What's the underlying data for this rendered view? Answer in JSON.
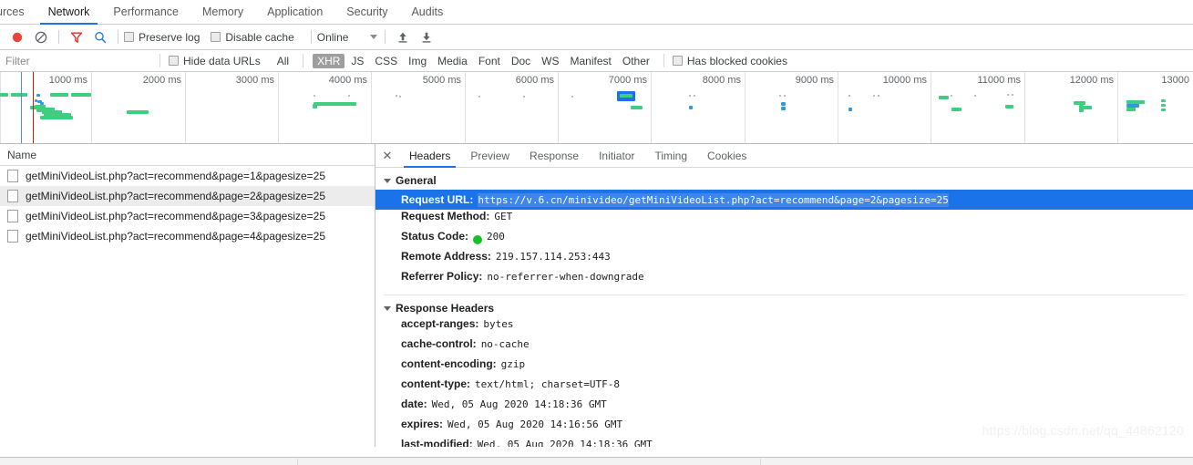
{
  "tabstrip": {
    "tabs": [
      {
        "label": "urces",
        "active": false,
        "clipped": true
      },
      {
        "label": "Network",
        "active": true
      },
      {
        "label": "Performance",
        "active": false
      },
      {
        "label": "Memory",
        "active": false
      },
      {
        "label": "Application",
        "active": false
      },
      {
        "label": "Security",
        "active": false
      },
      {
        "label": "Audits",
        "active": false
      }
    ]
  },
  "toolbar": {
    "record_icon": "record-icon",
    "clear_icon": "clear-icon",
    "filter_icon": "filter-icon",
    "search_icon": "search-icon",
    "preserve_log_label": "Preserve log",
    "preserve_log_checked": false,
    "disable_cache_label": "Disable cache",
    "disable_cache_checked": false,
    "throttling_value": "Online",
    "import_icon": "upload-arrow-icon",
    "export_icon": "download-arrow-icon",
    "record_color": "#e8453c",
    "filter_color": "#d93025",
    "search_color": "#1a73e8"
  },
  "filterbar": {
    "filter_placeholder": "Filter",
    "filter_value": "",
    "hide_data_urls_label": "Hide data URLs",
    "hide_data_urls_checked": false,
    "types": [
      {
        "label": "All",
        "selected": false
      },
      {
        "label": "XHR",
        "selected": true
      },
      {
        "label": "JS",
        "selected": false
      },
      {
        "label": "CSS",
        "selected": false
      },
      {
        "label": "Img",
        "selected": false
      },
      {
        "label": "Media",
        "selected": false
      },
      {
        "label": "Font",
        "selected": false
      },
      {
        "label": "Doc",
        "selected": false
      },
      {
        "label": "WS",
        "selected": false
      },
      {
        "label": "Manifest",
        "selected": false
      },
      {
        "label": "Other",
        "selected": false
      }
    ],
    "has_blocked_cookies_label": "Has blocked cookies",
    "has_blocked_cookies_checked": false
  },
  "overview": {
    "tick_labels": [
      "1000 ms",
      "2000 ms",
      "3000 ms",
      "4000 ms",
      "5000 ms",
      "6000 ms",
      "7000 ms",
      "8000 ms",
      "9000 ms",
      "10000 ms",
      "11000 ms",
      "12000 ms",
      "13000"
    ],
    "tick_x": [
      100,
      203,
      305,
      407,
      510,
      612,
      714,
      817,
      919,
      1021,
      1124,
      1226,
      1309
    ],
    "bar_color": "#41cd7f",
    "selected_bar_color": "#1a73e8",
    "dom_marker_color": "#4d8ee0",
    "load_marker_color": "#a52714"
  },
  "requests": {
    "column_header": "Name",
    "rows": [
      {
        "name": "getMiniVideoList.php?act=recommend&page=1&pagesize=25",
        "selected": false
      },
      {
        "name": "getMiniVideoList.php?act=recommend&page=2&pagesize=25",
        "selected": true
      },
      {
        "name": "getMiniVideoList.php?act=recommend&page=3&pagesize=25",
        "selected": false
      },
      {
        "name": "getMiniVideoList.php?act=recommend&page=4&pagesize=25",
        "selected": false
      }
    ]
  },
  "detail": {
    "close_label": "✕",
    "tabs": [
      {
        "label": "Headers",
        "active": true
      },
      {
        "label": "Preview",
        "active": false
      },
      {
        "label": "Response",
        "active": false
      },
      {
        "label": "Initiator",
        "active": false
      },
      {
        "label": "Timing",
        "active": false
      },
      {
        "label": "Cookies",
        "active": false
      }
    ],
    "general": {
      "title": "General",
      "items": [
        {
          "key": "Request URL:",
          "value": "https://v.6.cn/minivideo/getMiniVideoList.php?act=recommend&page=2&pagesize=25",
          "highlight": true
        },
        {
          "key": "Request Method:",
          "value": "GET"
        },
        {
          "key": "Status Code:",
          "value": "200",
          "status_dot": true
        },
        {
          "key": "Remote Address:",
          "value": "219.157.114.253:443"
        },
        {
          "key": "Referrer Policy:",
          "value": "no-referrer-when-downgrade"
        }
      ]
    },
    "response_headers": {
      "title": "Response Headers",
      "items": [
        {
          "key": "accept-ranges:",
          "value": "bytes"
        },
        {
          "key": "cache-control:",
          "value": "no-cache"
        },
        {
          "key": "content-encoding:",
          "value": "gzip"
        },
        {
          "key": "content-type:",
          "value": "text/html; charset=UTF-8"
        },
        {
          "key": "date:",
          "value": "Wed, 05 Aug 2020 14:18:36 GMT"
        },
        {
          "key": "expires:",
          "value": "Wed, 05 Aug 2020 14:16:56 GMT"
        },
        {
          "key": "last-modified:",
          "value": "Wed, 05 Aug 2020 14:18:36 GMT"
        }
      ]
    }
  },
  "watermark": "https://blog.csdn.net/qq_44862120"
}
